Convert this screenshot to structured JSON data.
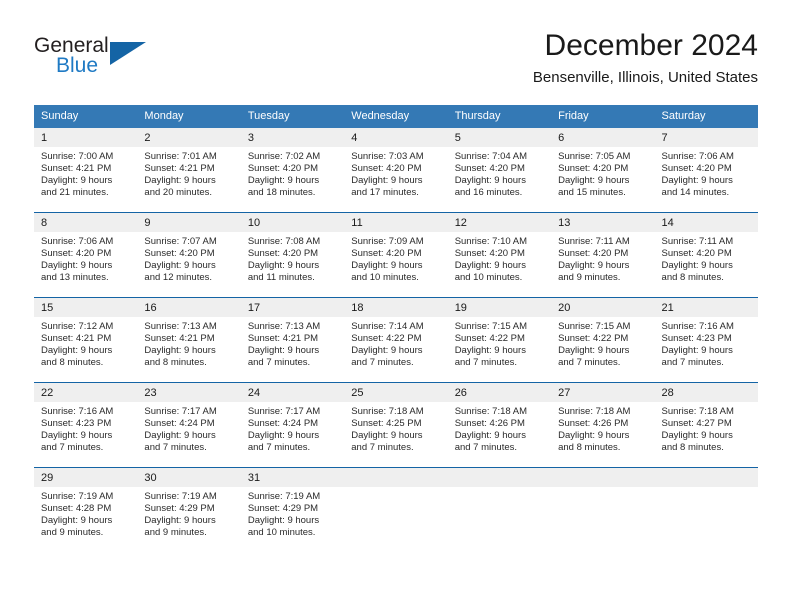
{
  "brand": {
    "name_part1": "General",
    "name_part2": "Blue",
    "logo_icon": "triangle-logo-icon"
  },
  "header": {
    "title": "December 2024",
    "location": "Bensenville, Illinois, United States"
  },
  "colors": {
    "header_blue": "#3479b5",
    "rule_blue": "#1464a5",
    "daynum_band": "#efefef",
    "brand_blue": "#1f7ac4"
  },
  "weekday_headers": [
    "Sunday",
    "Monday",
    "Tuesday",
    "Wednesday",
    "Thursday",
    "Friday",
    "Saturday"
  ],
  "weeks": [
    [
      {
        "day": "1",
        "sunrise": "Sunrise: 7:00 AM",
        "sunset": "Sunset: 4:21 PM",
        "daylight_line1": "Daylight: 9 hours",
        "daylight_line2": "and 21 minutes."
      },
      {
        "day": "2",
        "sunrise": "Sunrise: 7:01 AM",
        "sunset": "Sunset: 4:21 PM",
        "daylight_line1": "Daylight: 9 hours",
        "daylight_line2": "and 20 minutes."
      },
      {
        "day": "3",
        "sunrise": "Sunrise: 7:02 AM",
        "sunset": "Sunset: 4:20 PM",
        "daylight_line1": "Daylight: 9 hours",
        "daylight_line2": "and 18 minutes."
      },
      {
        "day": "4",
        "sunrise": "Sunrise: 7:03 AM",
        "sunset": "Sunset: 4:20 PM",
        "daylight_line1": "Daylight: 9 hours",
        "daylight_line2": "and 17 minutes."
      },
      {
        "day": "5",
        "sunrise": "Sunrise: 7:04 AM",
        "sunset": "Sunset: 4:20 PM",
        "daylight_line1": "Daylight: 9 hours",
        "daylight_line2": "and 16 minutes."
      },
      {
        "day": "6",
        "sunrise": "Sunrise: 7:05 AM",
        "sunset": "Sunset: 4:20 PM",
        "daylight_line1": "Daylight: 9 hours",
        "daylight_line2": "and 15 minutes."
      },
      {
        "day": "7",
        "sunrise": "Sunrise: 7:06 AM",
        "sunset": "Sunset: 4:20 PM",
        "daylight_line1": "Daylight: 9 hours",
        "daylight_line2": "and 14 minutes."
      }
    ],
    [
      {
        "day": "8",
        "sunrise": "Sunrise: 7:06 AM",
        "sunset": "Sunset: 4:20 PM",
        "daylight_line1": "Daylight: 9 hours",
        "daylight_line2": "and 13 minutes."
      },
      {
        "day": "9",
        "sunrise": "Sunrise: 7:07 AM",
        "sunset": "Sunset: 4:20 PM",
        "daylight_line1": "Daylight: 9 hours",
        "daylight_line2": "and 12 minutes."
      },
      {
        "day": "10",
        "sunrise": "Sunrise: 7:08 AM",
        "sunset": "Sunset: 4:20 PM",
        "daylight_line1": "Daylight: 9 hours",
        "daylight_line2": "and 11 minutes."
      },
      {
        "day": "11",
        "sunrise": "Sunrise: 7:09 AM",
        "sunset": "Sunset: 4:20 PM",
        "daylight_line1": "Daylight: 9 hours",
        "daylight_line2": "and 10 minutes."
      },
      {
        "day": "12",
        "sunrise": "Sunrise: 7:10 AM",
        "sunset": "Sunset: 4:20 PM",
        "daylight_line1": "Daylight: 9 hours",
        "daylight_line2": "and 10 minutes."
      },
      {
        "day": "13",
        "sunrise": "Sunrise: 7:11 AM",
        "sunset": "Sunset: 4:20 PM",
        "daylight_line1": "Daylight: 9 hours",
        "daylight_line2": "and 9 minutes."
      },
      {
        "day": "14",
        "sunrise": "Sunrise: 7:11 AM",
        "sunset": "Sunset: 4:20 PM",
        "daylight_line1": "Daylight: 9 hours",
        "daylight_line2": "and 8 minutes."
      }
    ],
    [
      {
        "day": "15",
        "sunrise": "Sunrise: 7:12 AM",
        "sunset": "Sunset: 4:21 PM",
        "daylight_line1": "Daylight: 9 hours",
        "daylight_line2": "and 8 minutes."
      },
      {
        "day": "16",
        "sunrise": "Sunrise: 7:13 AM",
        "sunset": "Sunset: 4:21 PM",
        "daylight_line1": "Daylight: 9 hours",
        "daylight_line2": "and 8 minutes."
      },
      {
        "day": "17",
        "sunrise": "Sunrise: 7:13 AM",
        "sunset": "Sunset: 4:21 PM",
        "daylight_line1": "Daylight: 9 hours",
        "daylight_line2": "and 7 minutes."
      },
      {
        "day": "18",
        "sunrise": "Sunrise: 7:14 AM",
        "sunset": "Sunset: 4:22 PM",
        "daylight_line1": "Daylight: 9 hours",
        "daylight_line2": "and 7 minutes."
      },
      {
        "day": "19",
        "sunrise": "Sunrise: 7:15 AM",
        "sunset": "Sunset: 4:22 PM",
        "daylight_line1": "Daylight: 9 hours",
        "daylight_line2": "and 7 minutes."
      },
      {
        "day": "20",
        "sunrise": "Sunrise: 7:15 AM",
        "sunset": "Sunset: 4:22 PM",
        "daylight_line1": "Daylight: 9 hours",
        "daylight_line2": "and 7 minutes."
      },
      {
        "day": "21",
        "sunrise": "Sunrise: 7:16 AM",
        "sunset": "Sunset: 4:23 PM",
        "daylight_line1": "Daylight: 9 hours",
        "daylight_line2": "and 7 minutes."
      }
    ],
    [
      {
        "day": "22",
        "sunrise": "Sunrise: 7:16 AM",
        "sunset": "Sunset: 4:23 PM",
        "daylight_line1": "Daylight: 9 hours",
        "daylight_line2": "and 7 minutes."
      },
      {
        "day": "23",
        "sunrise": "Sunrise: 7:17 AM",
        "sunset": "Sunset: 4:24 PM",
        "daylight_line1": "Daylight: 9 hours",
        "daylight_line2": "and 7 minutes."
      },
      {
        "day": "24",
        "sunrise": "Sunrise: 7:17 AM",
        "sunset": "Sunset: 4:24 PM",
        "daylight_line1": "Daylight: 9 hours",
        "daylight_line2": "and 7 minutes."
      },
      {
        "day": "25",
        "sunrise": "Sunrise: 7:18 AM",
        "sunset": "Sunset: 4:25 PM",
        "daylight_line1": "Daylight: 9 hours",
        "daylight_line2": "and 7 minutes."
      },
      {
        "day": "26",
        "sunrise": "Sunrise: 7:18 AM",
        "sunset": "Sunset: 4:26 PM",
        "daylight_line1": "Daylight: 9 hours",
        "daylight_line2": "and 7 minutes."
      },
      {
        "day": "27",
        "sunrise": "Sunrise: 7:18 AM",
        "sunset": "Sunset: 4:26 PM",
        "daylight_line1": "Daylight: 9 hours",
        "daylight_line2": "and 8 minutes."
      },
      {
        "day": "28",
        "sunrise": "Sunrise: 7:18 AM",
        "sunset": "Sunset: 4:27 PM",
        "daylight_line1": "Daylight: 9 hours",
        "daylight_line2": "and 8 minutes."
      }
    ],
    [
      {
        "day": "29",
        "sunrise": "Sunrise: 7:19 AM",
        "sunset": "Sunset: 4:28 PM",
        "daylight_line1": "Daylight: 9 hours",
        "daylight_line2": "and 9 minutes."
      },
      {
        "day": "30",
        "sunrise": "Sunrise: 7:19 AM",
        "sunset": "Sunset: 4:29 PM",
        "daylight_line1": "Daylight: 9 hours",
        "daylight_line2": "and 9 minutes."
      },
      {
        "day": "31",
        "sunrise": "Sunrise: 7:19 AM",
        "sunset": "Sunset: 4:29 PM",
        "daylight_line1": "Daylight: 9 hours",
        "daylight_line2": "and 10 minutes."
      },
      {
        "day": "",
        "sunrise": "",
        "sunset": "",
        "daylight_line1": "",
        "daylight_line2": ""
      },
      {
        "day": "",
        "sunrise": "",
        "sunset": "",
        "daylight_line1": "",
        "daylight_line2": ""
      },
      {
        "day": "",
        "sunrise": "",
        "sunset": "",
        "daylight_line1": "",
        "daylight_line2": ""
      },
      {
        "day": "",
        "sunrise": "",
        "sunset": "",
        "daylight_line1": "",
        "daylight_line2": ""
      }
    ]
  ]
}
